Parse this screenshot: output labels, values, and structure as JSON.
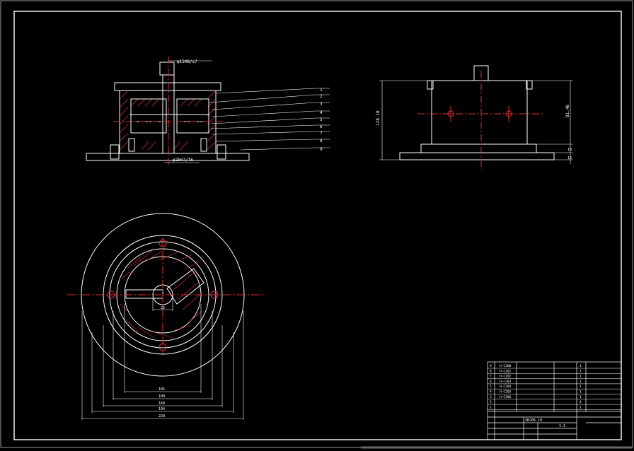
{
  "drawing": {
    "top_fit_label": "φ15H8/s7",
    "bottom_fit_label": "φ25H7/f6",
    "parts_callouts": [
      "1",
      "2",
      "3",
      "4",
      "5",
      "6",
      "7",
      "8",
      "9"
    ],
    "side_height_label": "128.10",
    "side_inner_height_label": "81.46",
    "side_base_label_1": "10",
    "side_base_label_2": "15",
    "plan_center_dim": "26",
    "plan_dims": [
      "185",
      "100",
      "160",
      "194",
      "228"
    ]
  },
  "title_block": {
    "rows": [
      {
        "no": "9",
        "code": "H-C200",
        "name": "",
        "qty": "1"
      },
      {
        "no": "8",
        "code": "H-C201",
        "name": "",
        "qty": "1"
      },
      {
        "no": "7",
        "code": "H-C202",
        "name": "",
        "qty": "1"
      },
      {
        "no": "6",
        "code": "H-C203",
        "name": "",
        "qty": "1"
      },
      {
        "no": "5",
        "code": "H-C204",
        "name": "",
        "qty": "1"
      },
      {
        "no": "4",
        "code": "H-C205",
        "name": "",
        "qty": "1"
      },
      {
        "no": "3",
        "code": "H-C206",
        "name": "",
        "qty": "1"
      },
      {
        "no": "2",
        "code": "",
        "name": "",
        "qty": "4"
      },
      {
        "no": "1",
        "code": "",
        "name": "",
        "qty": "1"
      }
    ],
    "drawing_no": "XBJ06.10",
    "scale": "1:1"
  }
}
